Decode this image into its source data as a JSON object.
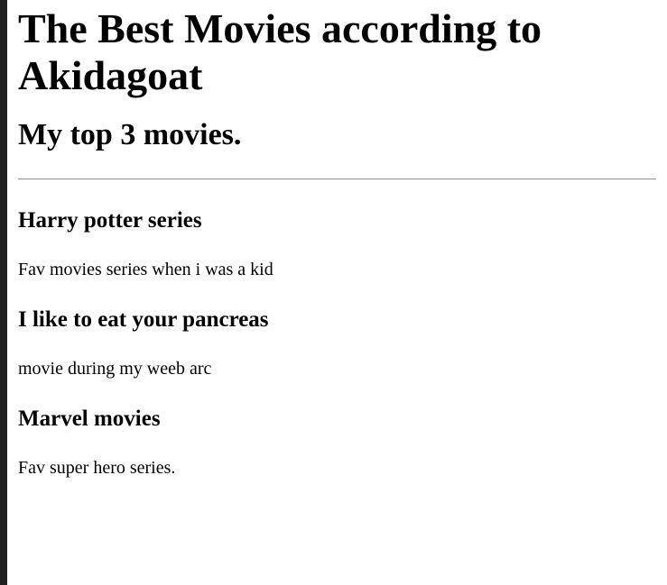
{
  "page": {
    "title": "The Best Movies according to Akidagoat",
    "subtitle": "My top 3 movies."
  },
  "movies": [
    {
      "title": "Harry potter series",
      "description": "Fav movies series when i was a kid"
    },
    {
      "title": "I like to eat your pancreas",
      "description": "movie during my weeb arc"
    },
    {
      "title": "Marvel movies",
      "description": "Fav super hero series."
    }
  ]
}
